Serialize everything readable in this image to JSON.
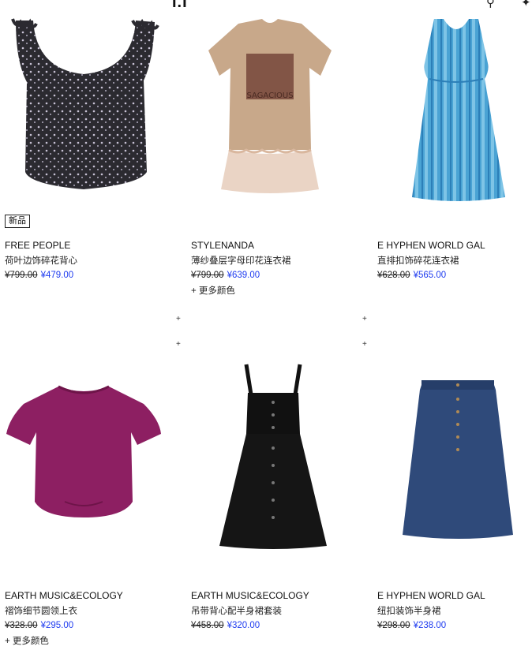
{
  "header": {
    "logo_text": "I.I",
    "search_icon": "search-icon",
    "bag_icon": "bag-icon"
  },
  "products": [
    {
      "badge": "新品",
      "brand": "FREE PEOPLE",
      "name": "荷叶边饰碎花背心",
      "old_price": "¥799.00",
      "new_price": "¥479.00",
      "more": "",
      "image": "black-floral-tank-top"
    },
    {
      "badge": "",
      "brand": "STYLENANDA",
      "name": "薄纱叠层字母印花连衣裙",
      "old_price": "¥799.00",
      "new_price": "¥639.00",
      "more": "+ 更多颜色",
      "image": "beige-tee-dress-with-tulle"
    },
    {
      "badge": "",
      "brand": "E HYPHEN WORLD GAL",
      "name": "直排扣饰碎花连衣裙",
      "old_price": "¥628.00",
      "new_price": "¥565.00",
      "more": "",
      "image": "blue-striped-floral-dress"
    },
    {
      "badge": "",
      "brand": "EARTH MUSIC&ECOLOGY",
      "name": "褶饰细节圆领上衣",
      "old_price": "¥328.00",
      "new_price": "¥295.00",
      "more": "+ 更多颜色",
      "image": "magenta-blouse"
    },
    {
      "badge": "",
      "brand": "EARTH MUSIC&ECOLOGY",
      "name": "吊带背心配半身裙套装",
      "old_price": "¥458.00",
      "new_price": "¥320.00",
      "more": "",
      "image": "black-pinafore-dress"
    },
    {
      "badge": "",
      "brand": "E HYPHEN WORLD GAL",
      "name": "纽扣装饰半身裙",
      "old_price": "¥298.00",
      "new_price": "¥238.00",
      "more": "",
      "image": "denim-button-skirt"
    }
  ],
  "colors": {
    "sale_price": "#1f3cf0",
    "background": "#ffffff"
  }
}
